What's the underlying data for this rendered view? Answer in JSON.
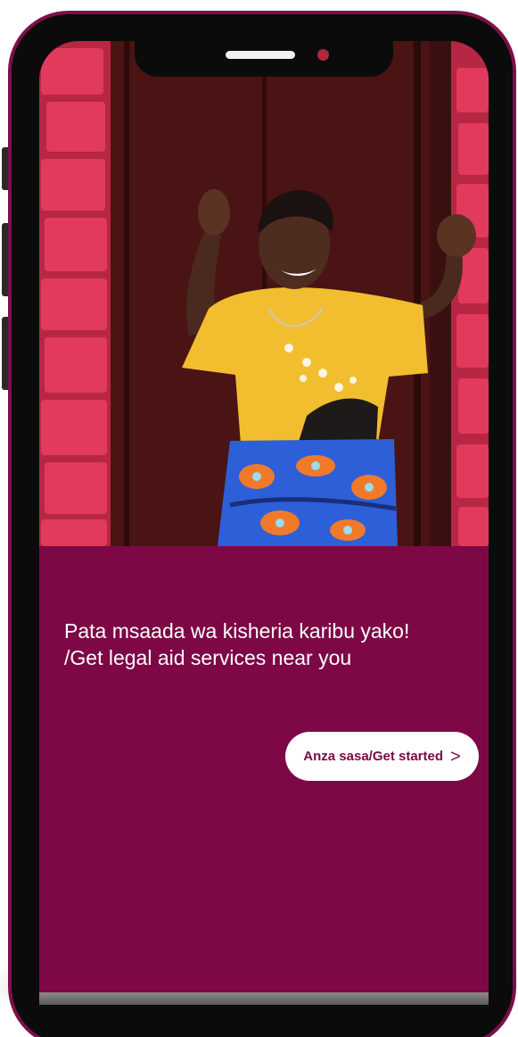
{
  "onboarding": {
    "headline_sw": "Pata msaada wa kisheria karibu yako!",
    "headline_en": "/Get legal aid services near you",
    "cta_label": "Anza sasa/Get started",
    "cta_icon": "chevron-right-icon",
    "cta_arrow": ">"
  },
  "colors": {
    "brand": "#7d0845",
    "frame": "#7d0f49",
    "cta_background": "#ffffff",
    "text": "#ffffff"
  }
}
